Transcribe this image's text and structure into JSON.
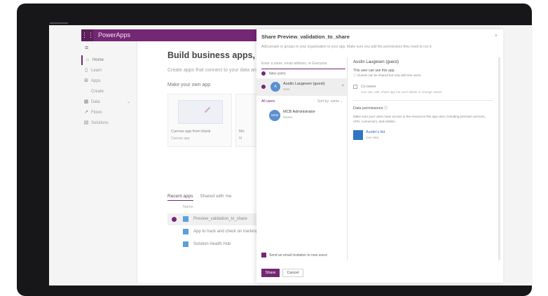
{
  "app": {
    "name": "PowerApps",
    "nav": [
      {
        "icon": "home-icon",
        "label": "Home",
        "active": true
      },
      {
        "icon": "learn-icon",
        "label": "Learn"
      },
      {
        "icon": "apps-icon",
        "label": "Apps"
      },
      {
        "icon": "",
        "label": "Create"
      },
      {
        "icon": "data-icon",
        "label": "Data",
        "expandable": true
      },
      {
        "icon": "flows-icon",
        "label": "Flows"
      },
      {
        "icon": "solutions-icon",
        "label": "Solutions"
      }
    ],
    "main": {
      "title": "Build business apps, fast",
      "subtitle": "Create apps that connect to your data and",
      "make_own": "Make your own app",
      "tiles": [
        {
          "label": "Canvas app from blank",
          "sub": "Canvas app"
        },
        {
          "label": "Mo",
          "sub": "M"
        }
      ],
      "tabs": [
        "Recent apps",
        "Shared with me"
      ],
      "column_header": "Name",
      "apps": [
        {
          "name": "Preview_validation_to_share",
          "selected": true
        },
        {
          "name": "App to track and check on tracking",
          "selected": false
        },
        {
          "name": "Solution Health Hub",
          "selected": false
        }
      ]
    }
  },
  "share": {
    "title": "Share Preview_validation_to_share",
    "close": "×",
    "description": "Add people or groups in your organization to your app. Make sure you add the permissions they need to run it.",
    "input_placeholder": "Enter a name, email address, or Everyone",
    "new_users_label": "New users",
    "selected_user": {
      "initials": "A",
      "name": "Austin Laugesen (guest)",
      "sub": "User"
    },
    "all_users_label": "All users",
    "sort_label": "Sort by: name ⌄",
    "other_user": {
      "initials": "MCB",
      "name": "MCB Administrator",
      "sub": "Owner"
    },
    "detail": {
      "name": "Austin Laugesen (guest)",
      "can_use": "This user can use this app.",
      "guest_note": "ⓘ Guests can be shared but only with few users.",
      "co_owner_label": "Co-owner",
      "co_owner_sub": "Can use, edit, share app but can't delete or change owner",
      "data_permissions_title": "Data permissions ⓘ",
      "data_permissions_desc": "Make sure your users have access to the resources this app uses, including premium services, APIs, connectors, and entities.",
      "data_item_name": "Austin's list",
      "data_item_sub": "Can view"
    },
    "send_email_label": "Send an email invitation to new users",
    "share_button": "Share",
    "cancel_button": "Cancel"
  },
  "colors": {
    "brand": "#742774",
    "link": "#2f74c6"
  }
}
